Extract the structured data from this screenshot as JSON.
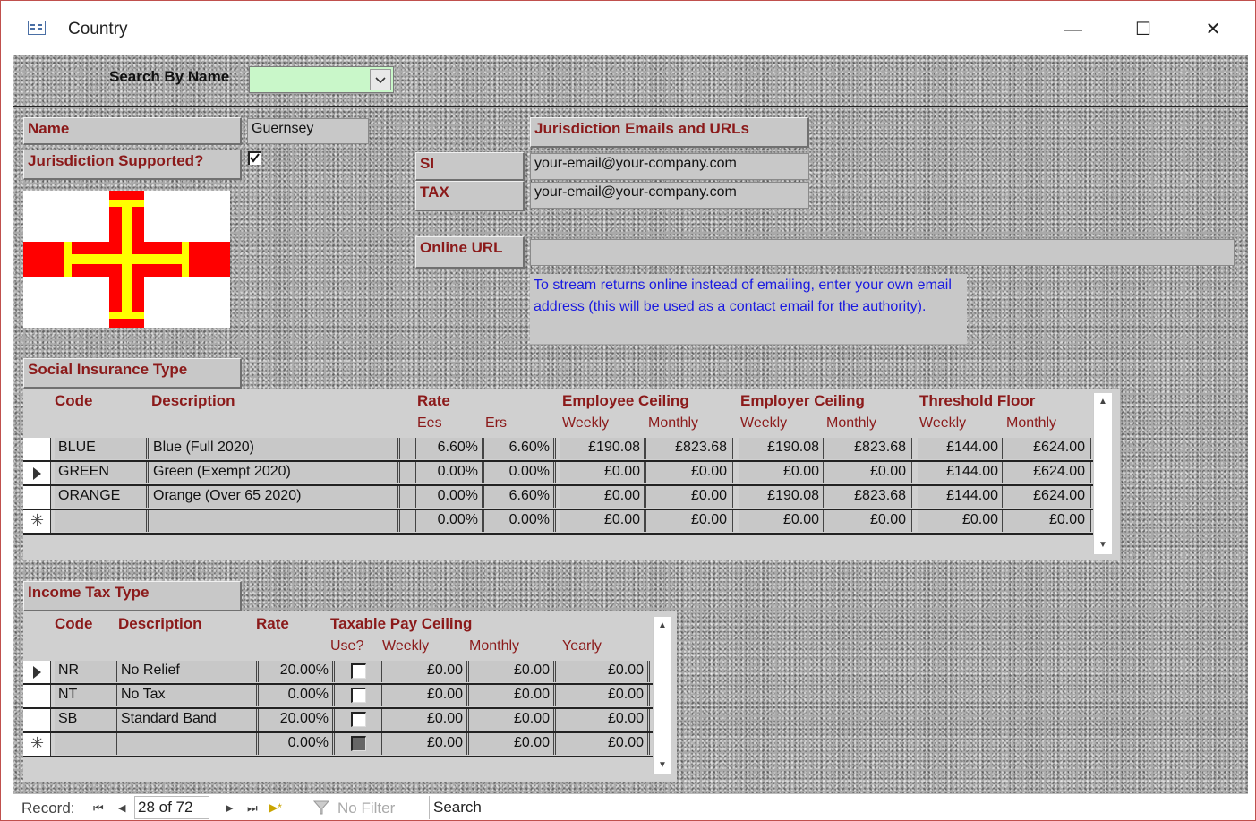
{
  "window": {
    "title": "Country",
    "minimize": "—",
    "maximize": "☐",
    "close": "✕"
  },
  "search": {
    "label": "Search By Name",
    "value": "",
    "dropdown_icon": "chevron-down-icon"
  },
  "name": {
    "label": "Name",
    "value": "Guernsey"
  },
  "jurisdiction_supported": {
    "label": "Jurisdiction Supported?",
    "checked": true
  },
  "emails": {
    "header": "Jurisdiction Emails and URLs",
    "si_label": "SI",
    "si_value": "your-email@your-company.com",
    "tax_label": "TAX",
    "tax_value": "your-email@your-company.com",
    "online_url_label": "Online URL",
    "online_url_value": "",
    "note": "To stream returns online instead of emailing, enter your own email address (this will be used as a contact email for the authority)."
  },
  "flag": {
    "colors": {
      "white": "#ffffff",
      "red": "#ff0000",
      "yellow": "#ffff00"
    }
  },
  "si_section": {
    "title": "Social Insurance Type",
    "headers": {
      "code": "Code",
      "description": "Description",
      "rate": "Rate",
      "ees": "Ees",
      "ers": "Ers",
      "employee_ceiling": "Employee Ceiling",
      "employer_ceiling": "Employer Ceiling",
      "threshold_floor": "Threshold Floor",
      "weekly": "Weekly",
      "monthly": "Monthly"
    },
    "rows": [
      {
        "code": "BLUE",
        "description": "Blue (Full 2020)",
        "ees": "6.60%",
        "ers": "6.60%",
        "emp_w": "£190.08",
        "emp_m": "£823.68",
        "er_w": "£190.08",
        "er_m": "£823.68",
        "th_w": "£144.00",
        "th_m": "£624.00"
      },
      {
        "code": "GREEN",
        "description": "Green (Exempt 2020)",
        "ees": "0.00%",
        "ers": "0.00%",
        "emp_w": "£0.00",
        "emp_m": "£0.00",
        "er_w": "£0.00",
        "er_m": "£0.00",
        "th_w": "£144.00",
        "th_m": "£624.00"
      },
      {
        "code": "ORANGE",
        "description": "Orange (Over 65 2020)",
        "ees": "0.00%",
        "ers": "6.60%",
        "emp_w": "£0.00",
        "emp_m": "£0.00",
        "er_w": "£190.08",
        "er_m": "£823.68",
        "th_w": "£144.00",
        "th_m": "£624.00"
      },
      {
        "code": "",
        "description": "",
        "ees": "0.00%",
        "ers": "0.00%",
        "emp_w": "£0.00",
        "emp_m": "£0.00",
        "er_w": "£0.00",
        "er_m": "£0.00",
        "th_w": "£0.00",
        "th_m": "£0.00"
      }
    ]
  },
  "it_section": {
    "title": "Income Tax Type",
    "headers": {
      "code": "Code",
      "description": "Description",
      "rate": "Rate",
      "taxable_pay_ceiling": "Taxable Pay Ceiling",
      "use": "Use?",
      "weekly": "Weekly",
      "monthly": "Monthly",
      "yearly": "Yearly"
    },
    "rows": [
      {
        "code": "NR",
        "description": "No Relief",
        "rate": "20.00%",
        "use": false,
        "weekly": "£0.00",
        "monthly": "£0.00",
        "yearly": "£0.00"
      },
      {
        "code": "NT",
        "description": "No Tax",
        "rate": "0.00%",
        "use": false,
        "weekly": "£0.00",
        "monthly": "£0.00",
        "yearly": "£0.00"
      },
      {
        "code": "SB",
        "description": "Standard Band",
        "rate": "20.00%",
        "use": false,
        "weekly": "£0.00",
        "monthly": "£0.00",
        "yearly": "£0.00"
      },
      {
        "code": "",
        "description": "",
        "rate": "0.00%",
        "use": null,
        "weekly": "£0.00",
        "monthly": "£0.00",
        "yearly": "£0.00"
      }
    ]
  },
  "navigation": {
    "record_label": "Record:",
    "first": "⏮",
    "prev": "◀",
    "position": "28 of 72",
    "next": "▶",
    "last": "⏭",
    "new": "▶*",
    "filter": "No Filter",
    "search_placeholder": "Search"
  }
}
